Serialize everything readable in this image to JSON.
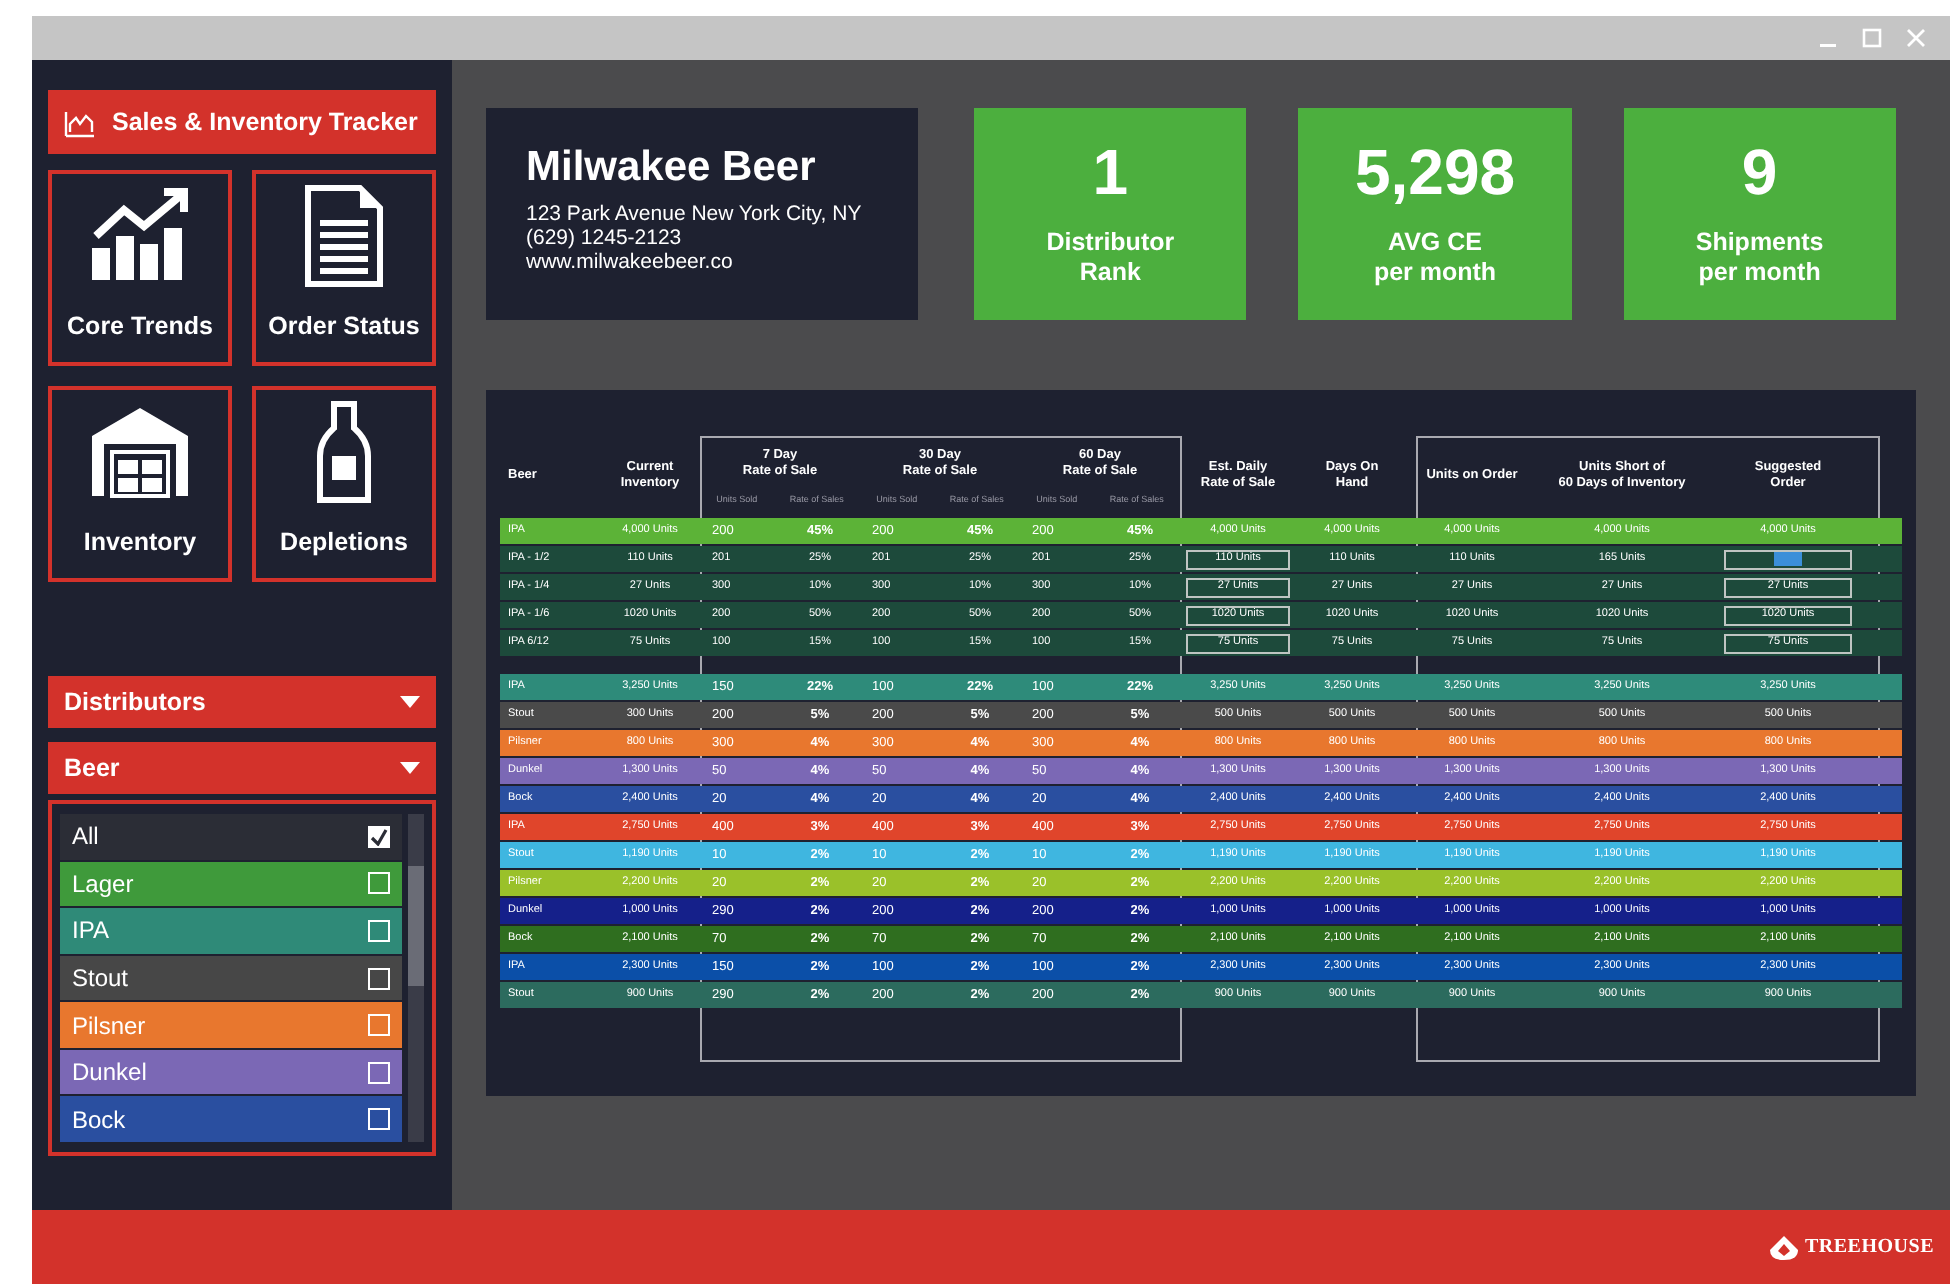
{
  "app": {
    "title": "Sales & Inventory Tracker"
  },
  "nav_tiles": [
    {
      "label": "Core Trends",
      "kind": "chart"
    },
    {
      "label": "Order Status",
      "kind": "document"
    },
    {
      "label": "Inventory",
      "kind": "warehouse"
    },
    {
      "label": "Depletions",
      "kind": "bottle"
    }
  ],
  "filters": [
    {
      "label": "Distributors"
    },
    {
      "label": "Beer",
      "options": [
        {
          "label": "All",
          "checked": true,
          "color": "#2b2d36"
        },
        {
          "label": "Lager",
          "checked": false,
          "color": "#3f9a3b"
        },
        {
          "label": "IPA",
          "checked": false,
          "color": "#2f8a78"
        },
        {
          "label": "Stout",
          "checked": false,
          "color": "#474747"
        },
        {
          "label": "Pilsner",
          "checked": false,
          "color": "#e8772e"
        },
        {
          "label": "Dunkel",
          "checked": false,
          "color": "#7b68b5"
        },
        {
          "label": "Bock",
          "checked": false,
          "color": "#2a4fa0"
        }
      ]
    }
  ],
  "company": {
    "name": "Milwakee Beer",
    "address": "123 Park Avenue New York City, NY",
    "phone": "(629) 1245-2123",
    "website": "www.milwakeebeer.co"
  },
  "stats": [
    {
      "value": "1",
      "label": [
        "Distributor",
        "Rank"
      ]
    },
    {
      "value": "5,298",
      "label": [
        "AVG CE",
        "per month"
      ]
    },
    {
      "value": "9",
      "label": [
        "Shipments",
        "per month"
      ]
    }
  ],
  "table": {
    "header": {
      "beer": "Beer",
      "inventory": [
        "Current",
        "Inventory"
      ],
      "rate_groups": [
        {
          "title": [
            "7 Day",
            "Rate of Sale"
          ],
          "units": "Units Sold",
          "rate": "Rate of Sales"
        },
        {
          "title": [
            "30 Day",
            "Rate of Sale"
          ],
          "units": "Units Sold",
          "rate": "Rate of Sales"
        },
        {
          "title": [
            "60 Day",
            "Rate of Sale"
          ],
          "units": "Units Sold",
          "rate": "Rate of Sales"
        }
      ],
      "est": [
        "Est. Daily",
        "Rate of Sale"
      ],
      "days": [
        "Days On",
        "Hand"
      ],
      "on_order": [
        "Units on Order"
      ],
      "short": [
        "Units Short of",
        "60 Days of Inventory"
      ],
      "suggested": [
        "Suggested",
        "Order"
      ]
    },
    "rows": [
      {
        "kind": "total",
        "color": "#5cb337",
        "beer": "IPA",
        "inventory": "4,000 Units",
        "rates": [
          [
            "200",
            "45%"
          ],
          [
            "200",
            "45%"
          ],
          [
            "200",
            "45%"
          ]
        ],
        "est": "4,000 Units",
        "days": "4,000 Units",
        "on_order": "4,000 Units",
        "short": "4,000 Units",
        "suggested": "4,000 Units"
      },
      {
        "kind": "sub",
        "color": "#1d4a3b",
        "beer": "IPA - 1/2",
        "inventory": "110 Units",
        "rates": [
          [
            "201",
            "25%"
          ],
          [
            "201",
            "25%"
          ],
          [
            "201",
            "25%"
          ]
        ],
        "est": "110 Units",
        "days": "110 Units",
        "on_order": "110 Units",
        "short": "165 Units",
        "selected": true
      },
      {
        "kind": "sub",
        "color": "#1d4a3b",
        "beer": "IPA - 1/4",
        "inventory": "27 Units",
        "rates": [
          [
            "300",
            "10%"
          ],
          [
            "300",
            "10%"
          ],
          [
            "300",
            "10%"
          ]
        ],
        "est": "27 Units",
        "days": "27 Units",
        "on_order": "27 Units",
        "short": "27 Units",
        "suggested": "27 Units",
        "selected": false
      },
      {
        "kind": "sub",
        "color": "#1d4a3b",
        "beer": "IPA - 1/6",
        "inventory": "1020 Units",
        "rates": [
          [
            "200",
            "50%"
          ],
          [
            "200",
            "50%"
          ],
          [
            "200",
            "50%"
          ]
        ],
        "est": "1020 Units",
        "days": "1020 Units",
        "on_order": "1020 Units",
        "short": "1020 Units",
        "suggested": "1020 Units",
        "selected": false
      },
      {
        "kind": "sub",
        "color": "#1d4a3b",
        "beer": "IPA 6/12",
        "inventory": "75 Units",
        "rates": [
          [
            "100",
            "15%"
          ],
          [
            "100",
            "15%"
          ],
          [
            "100",
            "15%"
          ]
        ],
        "est": "75 Units",
        "days": "75 Units",
        "on_order": "75 Units",
        "short": "75 Units",
        "suggested": "75 Units",
        "selected": false
      },
      {
        "kind": "category",
        "color": "#2e8b7a",
        "beer": "IPA",
        "inventory": "3,250 Units",
        "rates": [
          [
            "150",
            "22%"
          ],
          [
            "100",
            "22%"
          ],
          [
            "100",
            "22%"
          ]
        ],
        "est": "3,250 Units",
        "days": "3,250 Units",
        "on_order": "3,250 Units",
        "short": "3,250 Units",
        "suggested": "3,250 Units"
      },
      {
        "kind": "category",
        "color": "#4a4a4a",
        "beer": "Stout",
        "inventory": "300 Units",
        "rates": [
          [
            "200",
            "5%"
          ],
          [
            "200",
            "5%"
          ],
          [
            "200",
            "5%"
          ]
        ],
        "est": "500 Units",
        "days": "500 Units",
        "on_order": "500 Units",
        "short": "500 Units",
        "suggested": "500 Units"
      },
      {
        "kind": "category",
        "color": "#e8772e",
        "beer": "Pilsner",
        "inventory": "800 Units",
        "rates": [
          [
            "300",
            "4%"
          ],
          [
            "300",
            "4%"
          ],
          [
            "300",
            "4%"
          ]
        ],
        "est": "800 Units",
        "days": "800 Units",
        "on_order": "800 Units",
        "short": "800 Units",
        "suggested": "800 Units"
      },
      {
        "kind": "category",
        "color": "#7b68b5",
        "beer": "Dunkel",
        "inventory": "1,300 Units",
        "rates": [
          [
            "50",
            "4%"
          ],
          [
            "50",
            "4%"
          ],
          [
            "50",
            "4%"
          ]
        ],
        "est": "1,300 Units",
        "days": "1,300 Units",
        "on_order": "1,300 Units",
        "short": "1,300 Units",
        "suggested": "1,300 Units"
      },
      {
        "kind": "category",
        "color": "#2a4fa0",
        "beer": "Bock",
        "inventory": "2,400 Units",
        "rates": [
          [
            "20",
            "4%"
          ],
          [
            "20",
            "4%"
          ],
          [
            "20",
            "4%"
          ]
        ],
        "est": "2,400 Units",
        "days": "2,400 Units",
        "on_order": "2,400 Units",
        "short": "2,400 Units",
        "suggested": "2,400 Units"
      },
      {
        "kind": "category",
        "color": "#e0452b",
        "beer": "IPA",
        "inventory": "2,750 Units",
        "rates": [
          [
            "400",
            "3%"
          ],
          [
            "400",
            "3%"
          ],
          [
            "400",
            "3%"
          ]
        ],
        "est": "2,750 Units",
        "days": "2,750 Units",
        "on_order": "2,750 Units",
        "short": "2,750 Units",
        "suggested": "2,750 Units"
      },
      {
        "kind": "category",
        "color": "#3fb6e0",
        "beer": "Stout",
        "inventory": "1,190 Units",
        "rates": [
          [
            "10",
            "2%"
          ],
          [
            "10",
            "2%"
          ],
          [
            "10",
            "2%"
          ]
        ],
        "est": "1,190 Units",
        "days": "1,190 Units",
        "on_order": "1,190 Units",
        "short": "1,190 Units",
        "suggested": "1,190 Units"
      },
      {
        "kind": "category",
        "color": "#9ac12a",
        "beer": "Pilsner",
        "inventory": "2,200 Units",
        "rates": [
          [
            "20",
            "2%"
          ],
          [
            "20",
            "2%"
          ],
          [
            "20",
            "2%"
          ]
        ],
        "est": "2,200 Units",
        "days": "2,200 Units",
        "on_order": "2,200 Units",
        "short": "2,200 Units",
        "suggested": "2,200 Units"
      },
      {
        "kind": "category",
        "color": "#15208a",
        "beer": "Dunkel",
        "inventory": "1,000 Units",
        "rates": [
          [
            "290",
            "2%"
          ],
          [
            "200",
            "2%"
          ],
          [
            "200",
            "2%"
          ]
        ],
        "est": "1,000 Units",
        "days": "1,000 Units",
        "on_order": "1,000 Units",
        "short": "1,000 Units",
        "suggested": "1,000 Units"
      },
      {
        "kind": "category",
        "color": "#2f6e1f",
        "beer": "Bock",
        "inventory": "2,100 Units",
        "rates": [
          [
            "70",
            "2%"
          ],
          [
            "70",
            "2%"
          ],
          [
            "70",
            "2%"
          ]
        ],
        "est": "2,100 Units",
        "days": "2,100 Units",
        "on_order": "2,100 Units",
        "short": "2,100 Units",
        "suggested": "2,100 Units"
      },
      {
        "kind": "category",
        "color": "#0b4fa8",
        "beer": "IPA",
        "inventory": "2,300 Units",
        "rates": [
          [
            "150",
            "2%"
          ],
          [
            "100",
            "2%"
          ],
          [
            "100",
            "2%"
          ]
        ],
        "est": "2,300 Units",
        "days": "2,300 Units",
        "on_order": "2,300 Units",
        "short": "2,300 Units",
        "suggested": "2,300 Units"
      },
      {
        "kind": "category",
        "color": "#2c6b5e",
        "beer": "Stout",
        "inventory": "900 Units",
        "rates": [
          [
            "290",
            "2%"
          ],
          [
            "200",
            "2%"
          ],
          [
            "200",
            "2%"
          ]
        ],
        "est": "900 Units",
        "days": "900 Units",
        "on_order": "900 Units",
        "short": "900 Units",
        "suggested": "900 Units"
      }
    ]
  },
  "footer": {
    "logo": "TREEHOUSE"
  }
}
